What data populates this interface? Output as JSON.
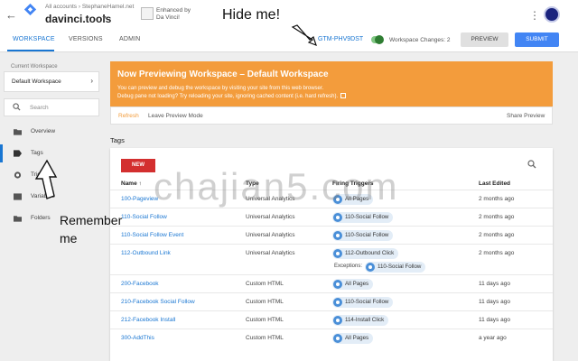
{
  "topbar": {
    "account_path": "All accounts › StephaneHamel.net",
    "container_name": "davinci.tools",
    "enhanced_line1": "Enhanced by",
    "enhanced_line2": "Da Vinci!"
  },
  "tabs": [
    {
      "label": "WORKSPACE",
      "active": true
    },
    {
      "label": "VERSIONS",
      "active": false
    },
    {
      "label": "ADMIN",
      "active": false
    }
  ],
  "toolbar": {
    "gtm_id": "GTM-PHV9DST",
    "workspace_changes": "Workspace Changes: 2",
    "preview_label": "PREVIEW",
    "submit_label": "SUBMIT"
  },
  "sidebar": {
    "current_workspace_label": "Current Workspace",
    "workspace_name": "Default Workspace",
    "search_placeholder": "Search",
    "items": [
      {
        "label": "Overview",
        "icon": "folder-icon",
        "active": false
      },
      {
        "label": "Tags",
        "icon": "tag-icon",
        "active": true
      },
      {
        "label": "Triggers",
        "icon": "trigger-icon",
        "active": false
      },
      {
        "label": "Variables",
        "icon": "variable-icon",
        "active": false
      },
      {
        "label": "Folders",
        "icon": "folder-icon",
        "active": false
      }
    ]
  },
  "banner": {
    "title": "Now Previewing Workspace – Default Workspace",
    "line1": "You can preview and debug the workspace by visiting your site from this web browser.",
    "line2": "Debug pane not loading? Try reloading your site, ignoring cached content (i.e. hard refresh).",
    "refresh": "Refresh",
    "leave": "Leave Preview Mode",
    "share": "Share Preview"
  },
  "tags_section": {
    "title": "Tags",
    "new_label": "NEW",
    "columns": {
      "name": "Name",
      "type": "Type",
      "triggers": "Firing Triggers",
      "edited": "Last Edited"
    },
    "rows": [
      {
        "name": "100-Pageview",
        "type": "Universal Analytics",
        "trigger": "All Pages",
        "edited": "2 months ago"
      },
      {
        "name": "110-Social Follow",
        "type": "Universal Analytics",
        "trigger": "110-Social Follow",
        "edited": "2 months ago"
      },
      {
        "name": "110-Social Follow Event",
        "type": "Universal Analytics",
        "trigger": "110-Social Follow",
        "edited": "2 months ago"
      },
      {
        "name": "112-Outbound Link",
        "type": "Universal Analytics",
        "trigger": "112-Outbound Click",
        "edited": "2 months ago",
        "exceptions_label": "Exceptions:",
        "exception": "110-Social Follow"
      },
      {
        "name": "200-Facebook",
        "type": "Custom HTML",
        "trigger": "All Pages",
        "edited": "11 days ago"
      },
      {
        "name": "210-Facebook Social Follow",
        "type": "Custom HTML",
        "trigger": "110-Social Follow",
        "edited": "11 days ago"
      },
      {
        "name": "212-Facebook Install",
        "type": "Custom HTML",
        "trigger": "114-Install Click",
        "edited": "11 days ago"
      },
      {
        "name": "300-AddThis",
        "type": "Custom HTML",
        "trigger": "All Pages",
        "edited": "a year ago"
      }
    ]
  },
  "annotations": {
    "hide_me": "Hide me!",
    "remember_line1": "Remember",
    "remember_line2": "me",
    "watermark": "chajian5.com"
  },
  "colors": {
    "accent": "#1976d2",
    "banner": "#f39c3c",
    "new_button": "#d32f2f",
    "submit_button": "#4285f4"
  }
}
